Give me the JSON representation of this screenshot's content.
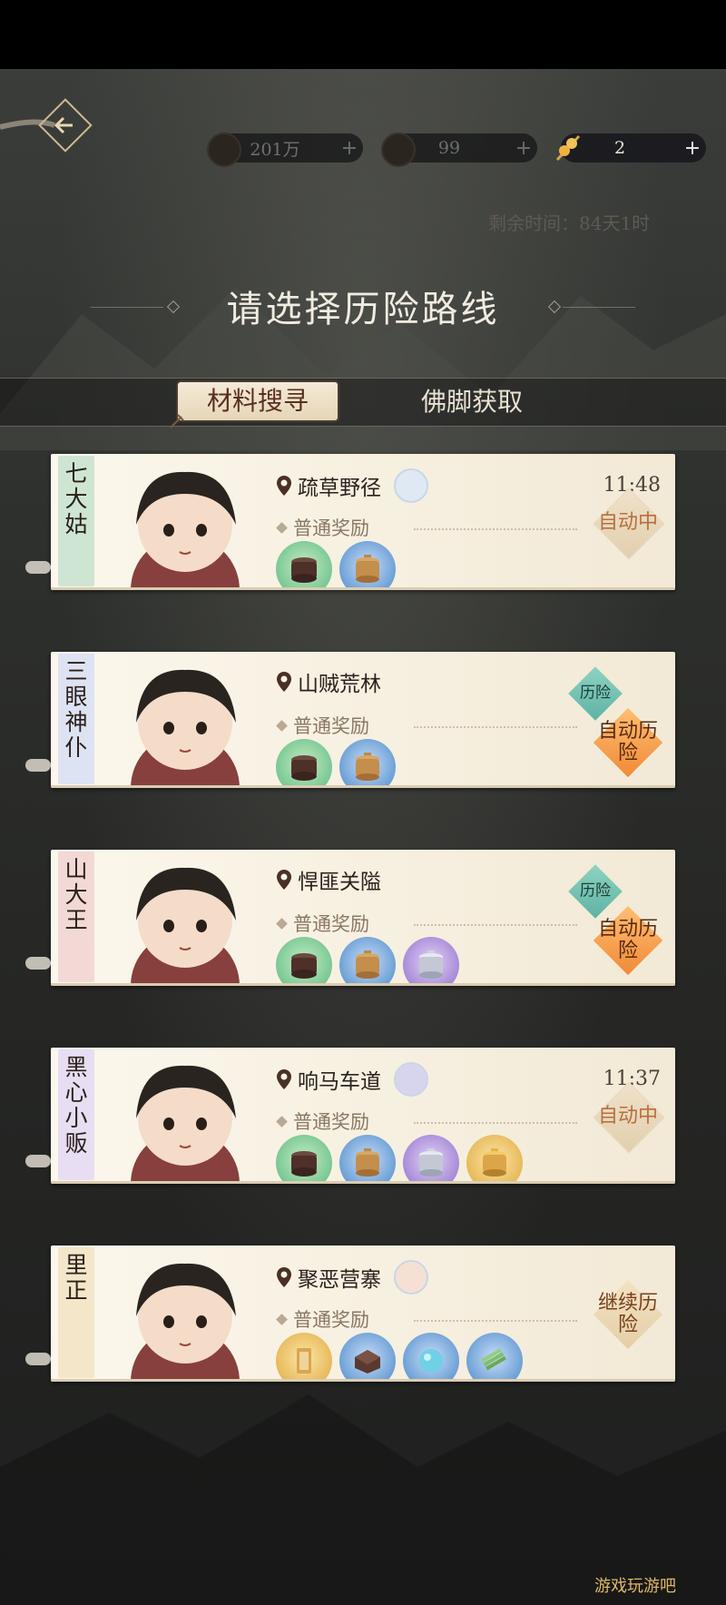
{
  "resources": [
    {
      "value": "201万",
      "plus": "+",
      "active": false
    },
    {
      "value": "99",
      "plus": "+",
      "active": false
    },
    {
      "value": "2",
      "plus": "+",
      "active": true
    }
  ],
  "timer": "剩余时间：84天1时",
  "title": "请选择历险路线",
  "tabs": [
    {
      "label": "材料搜寻",
      "selected": true
    },
    {
      "label": "佛脚获取",
      "selected": false
    }
  ],
  "cards": [
    {
      "name": "七大姑",
      "name_color": "#cfe5d3",
      "location": "疏草野径",
      "reward_label": "普通奖励",
      "items": [
        {
          "color": "green",
          "icon": "dark-pot-icon"
        },
        {
          "color": "blue",
          "icon": "bronze-pot-icon"
        }
      ],
      "time": "11:48",
      "buttons": [
        {
          "type": "auto-on",
          "label": "自动中"
        }
      ]
    },
    {
      "name": "三眼神仆",
      "name_color": "#dde3f3",
      "location": "山贼荒林",
      "reward_label": "普通奖励",
      "items": [
        {
          "color": "green",
          "icon": "dark-pot-icon"
        },
        {
          "color": "blue",
          "icon": "bronze-pot-icon"
        }
      ],
      "time": "",
      "buttons": [
        {
          "type": "adv",
          "label": "历险"
        },
        {
          "type": "auto",
          "label": "自动历险"
        }
      ]
    },
    {
      "name": "山大王",
      "name_color": "#f3d9d5",
      "location": "悍匪关隘",
      "reward_label": "普通奖励",
      "items": [
        {
          "color": "green",
          "icon": "dark-pot-icon"
        },
        {
          "color": "blue",
          "icon": "bronze-pot-icon"
        },
        {
          "color": "purple",
          "icon": "silver-pot-icon"
        }
      ],
      "time": "",
      "buttons": [
        {
          "type": "adv",
          "label": "历险"
        },
        {
          "type": "auto",
          "label": "自动历险"
        }
      ]
    },
    {
      "name": "黑心小贩",
      "name_color": "#e7def3",
      "location": "响马车道",
      "reward_label": "普通奖励",
      "items": [
        {
          "color": "green",
          "icon": "dark-pot-icon"
        },
        {
          "color": "blue",
          "icon": "bronze-pot-icon"
        },
        {
          "color": "purple",
          "icon": "silver-pot-icon"
        },
        {
          "color": "gold",
          "icon": "gold-pot-icon"
        }
      ],
      "time": "11:37",
      "buttons": [
        {
          "type": "auto-on",
          "label": "自动中"
        }
      ]
    },
    {
      "name": "里正",
      "name_color": "#f3e6c9",
      "location": "聚恶营寨",
      "reward_label": "普通奖励",
      "items": [
        {
          "color": "gold",
          "icon": "scroll-token-icon"
        },
        {
          "color": "blue",
          "icon": "ink-block-icon"
        },
        {
          "color": "blue",
          "icon": "jade-bead-icon"
        },
        {
          "color": "blue",
          "icon": "bamboo-slip-icon"
        }
      ],
      "time": "",
      "buttons": [
        {
          "type": "cont",
          "label": "继续历险"
        }
      ]
    }
  ],
  "watermark": "游戏玩游吧"
}
